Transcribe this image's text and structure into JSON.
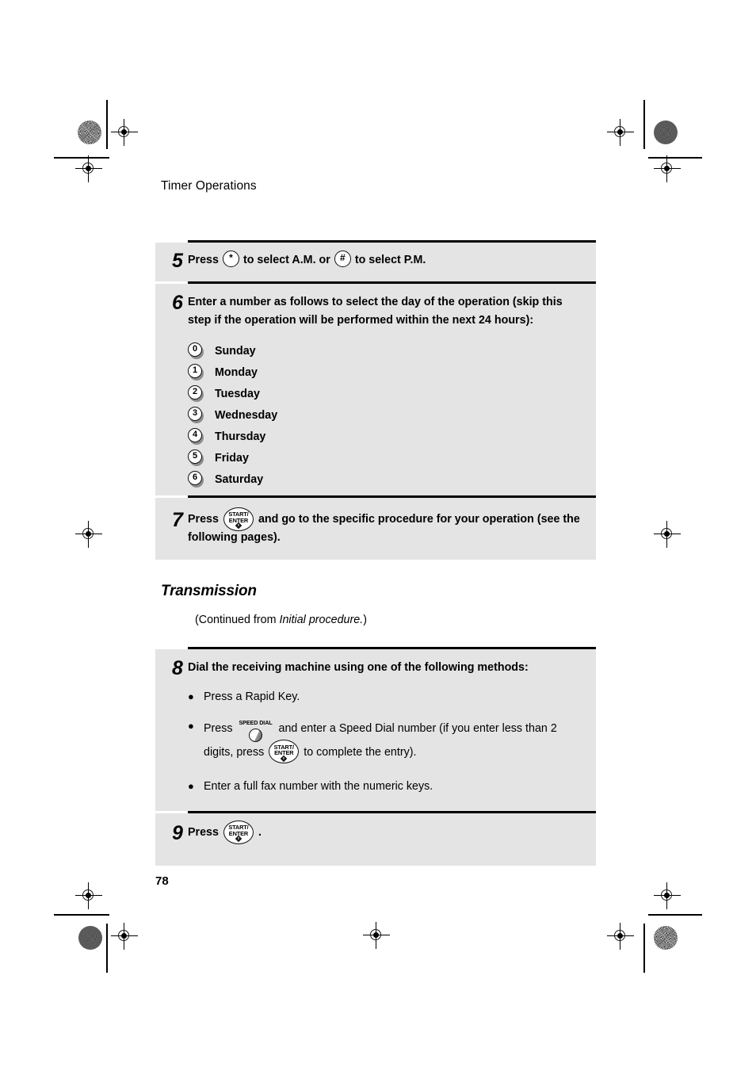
{
  "page": {
    "running_head": "Timer Operations",
    "folio": "78"
  },
  "steps": {
    "step5": {
      "number": "5",
      "text_before": "Press",
      "key_star": "*",
      "text_middle": "to select A.M. or",
      "key_hash": "#",
      "text_after": "to select P.M."
    },
    "step6": {
      "number": "6",
      "text": "Enter a number as follows to select the day of the operation (skip this step if the operation will be performed within the next 24 hours):",
      "days": [
        {
          "digit": "0",
          "label": "Sunday"
        },
        {
          "digit": "1",
          "label": "Monday"
        },
        {
          "digit": "2",
          "label": "Tuesday"
        },
        {
          "digit": "3",
          "label": "Wednesday"
        },
        {
          "digit": "4",
          "label": "Thursday"
        },
        {
          "digit": "5",
          "label": "Friday"
        },
        {
          "digit": "6",
          "label": "Saturday"
        }
      ]
    },
    "step7": {
      "number": "7",
      "text_before": "Press",
      "text_after": "and go to the specific procedure for your operation (see the following pages)."
    },
    "step8": {
      "number": "8",
      "text": "Dial the receiving machine using one of the following methods:",
      "bullet1": "Press a Rapid Key.",
      "bullet2_before": "Press",
      "bullet2_middle": "and enter a Speed Dial number (if you enter less than 2 digits, press",
      "bullet2_after": "to complete the entry).",
      "bullet3": "Enter a full fax number with the numeric keys."
    },
    "step9": {
      "number": "9",
      "text_before": "Press",
      "text_after": "."
    }
  },
  "section": {
    "heading": "Transmission",
    "continued_before": "(Continued from ",
    "continued_italic": "Initial procedure.",
    "continued_after": ")"
  },
  "keys": {
    "start_enter_line1": "START/",
    "start_enter_line2": "ENTER",
    "speed_dial_label": "SPEED DIAL"
  },
  "bullet_glyph": "●"
}
